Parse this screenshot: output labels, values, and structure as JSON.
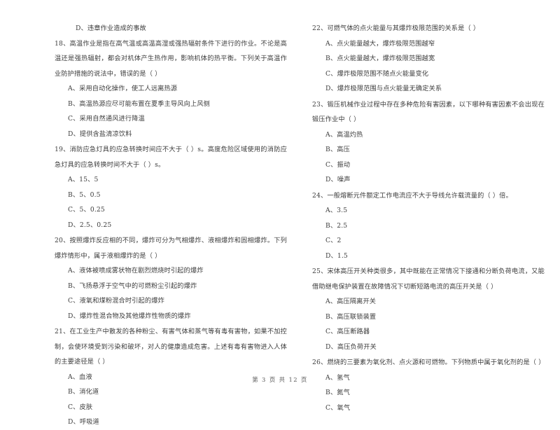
{
  "document": {
    "type": "exam-paper",
    "language": "zh-CN",
    "footer": "第 3 页 共 12 页",
    "page_number": "3",
    "total_pages": "12"
  },
  "left_column": {
    "orphan_option": "D、违章作业造成的事故",
    "questions": [
      {
        "number": "18",
        "stem": "18、高温作业是指在高气温或高温高湿或强热辐射条件下进行的作业。不论是高温还是强热辐射，都会对机体产生热作用，影响机体的热平衡。下列关于高温作业防护措施的说法中，错误的是（      ）",
        "options": [
          "A、采用自动化操作，使工人远离热源",
          "B、高温热源应尽可能布置在夏季主导风向上风侧",
          "C、采用自然通风进行降温",
          "D、提供含盐清凉饮料"
        ]
      },
      {
        "number": "19",
        "stem": "19、消防应急灯具的应急转换时间应不大于（      ）s。高度危险区域使用的消防应急灯具的应急转换时间不大于（      ）s。",
        "options": [
          "A、15、5",
          "B、5、0.5",
          "C、5、0.25",
          "D、2.5、0.25"
        ]
      },
      {
        "number": "20",
        "stem": "20、按照爆炸反应相的不同，爆炸可分为气相爆炸、液相爆炸和固相爆炸。下列爆炸情形中，属于液相爆炸的是（      ）",
        "options": [
          "A、液体被喷成雾状物在剧烈燃烧时引起的爆炸",
          "B、飞扬悬浮于空气中的可燃粉尘引起的爆炸",
          "C、液氧和煤粉混合时引起的爆炸",
          "D、爆炸性混合物及其他爆炸性物质的爆炸"
        ]
      },
      {
        "number": "21",
        "stem": "21、在工业生产中散发的各种粉尘、有害气体和蒸气等有毒有害物，如果不加控制，会使环境受到污染和破坏，对人的健康造成危害。上述有毒有害物进入人体的主要途径是（      ）",
        "options": [
          "A、血液",
          "B、消化道",
          "C、皮肤",
          "D、呼吸道"
        ]
      }
    ]
  },
  "right_column": {
    "questions": [
      {
        "number": "22",
        "stem": "22、可燃气体的点火能量与其爆炸极限范围的关系是（      ）",
        "options": [
          "A、点火能量越大，爆炸极限范围越窄",
          "B、点火能量越大，爆炸极限范围越宽",
          "C、爆炸极限范围不随点火能量变化",
          "D、爆炸极限范围与点火能量无确定关系"
        ]
      },
      {
        "number": "23",
        "stem": "23、锻压机械作业过程中存在多种危险有害因素，以下哪种有害因素不会出现在锻压作业中（      ）",
        "options": [
          "A、高温灼热",
          "B、高压",
          "C、振动",
          "D、噪声"
        ]
      },
      {
        "number": "24",
        "stem": "24、一般熔断元件额定工作电流应不大于导线允许载流量的（      ）倍。",
        "options": [
          "A、3.5",
          "B、2.5",
          "C、2",
          "D、1.5"
        ]
      },
      {
        "number": "25",
        "stem": "25、宋体高压开关种类很多，其中既能在正常情况下接通和分断负荷电流，又能借助继电保护装置在故障情况下切断短路电流的高压开关是（      ）",
        "options": [
          "A、高压隔离开关",
          "B、高压联锁装置",
          "C、高压断路器",
          "D、高压负荷开关"
        ]
      },
      {
        "number": "26",
        "stem": "26、燃烧的三要素为氧化剂、点火源和可燃物。下列物质中属于氧化剂的是（      ）",
        "options": [
          "A、氢气",
          "B、氮气",
          "C、氧气"
        ]
      }
    ]
  }
}
